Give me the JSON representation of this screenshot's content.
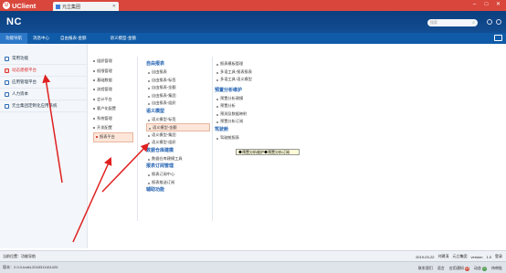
{
  "app": {
    "name": "UClient",
    "doc_tab": "元立集团"
  },
  "header": {
    "brand": "NC",
    "search_placeholder": "搜索"
  },
  "menubar": {
    "items": [
      "功能导航",
      "消息中心",
      "自由报表-金额",
      "语义模型-金额"
    ]
  },
  "left_panel": {
    "items": [
      "常用功能",
      "动态建模平台",
      "应用管理平台",
      "人力资本",
      "元立集团定制化应用系统"
    ]
  },
  "col2": {
    "items": [
      "组织管理",
      "权限管理",
      "基础数据",
      "流程管理",
      "会计平台",
      "客户化配置",
      "系统管理",
      "开发配置",
      "报表平台"
    ]
  },
  "col3": {
    "g1": {
      "title": "自由报表",
      "items": [
        "自由报表",
        "自由报表-标签",
        "自由报表-金额",
        "自由报表-集团",
        "自由报表-组织"
      ]
    },
    "g2": {
      "title": "语义模型",
      "items": [
        "语义模型-标签",
        "语义模型-金额",
        "语义模型-集团",
        "语义模型-组织"
      ]
    },
    "g3": {
      "title": "数据仓库建模",
      "items": [
        "数据仓库建模工具"
      ]
    },
    "g4": {
      "title": "报表订阅管理",
      "items": [
        "报表订阅中心",
        "报表推送订阅"
      ]
    },
    "g5": {
      "title": "辅助功能"
    }
  },
  "col4": {
    "top_items": [
      "报表模板管理",
      "多语工具-报表报表",
      "多语工具-语义模型"
    ],
    "g1": {
      "title": "预置分析维护",
      "items": [
        "预置分析建模",
        "预置分析",
        "预测及数据映射",
        "预置分析订阅"
      ]
    },
    "g2": {
      "title": "驾驶舱",
      "items": [
        "驾驶舱报表"
      ]
    },
    "tooltip": "◆预置分析维护◆预置分析订阅"
  },
  "statusbar": {
    "current": "当前位置：功能导航",
    "date": "2019-03-22",
    "user_label": "刘建涛",
    "group": "元立集团",
    "version": "version",
    "btn": "1.0",
    "login": "登录"
  },
  "bottombar": {
    "version": "版本：2.0.0-build-2018311161420",
    "items": [
      "联系我们",
      "语言",
      "应用通知",
      "动态",
      "待审批"
    ],
    "badges": [
      "13",
      "0"
    ]
  },
  "accent": "#d9473c"
}
